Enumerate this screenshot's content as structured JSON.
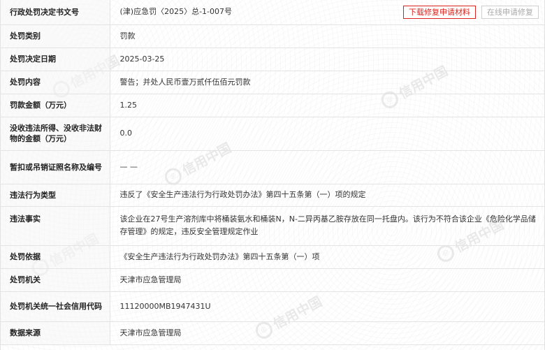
{
  "watermark": {
    "text": "信用中国",
    "logo_icon": "credit-china-logo-icon"
  },
  "actions": {
    "download_label": "下载修复申请材料",
    "online_label": "在线申请修复"
  },
  "rows": [
    {
      "key": "行政处罚决定书文号",
      "value": "(津)应急罚〈2025〉总-1-007号"
    },
    {
      "key": "处罚类别",
      "value": "罚款"
    },
    {
      "key": "处罚决定日期",
      "value": "2025-03-25"
    },
    {
      "key": "处罚内容",
      "value": "警告；并处人民币壹万贰仟伍佰元罚款"
    },
    {
      "key": "罚款金额（万元）",
      "value": "1.25"
    },
    {
      "key": "没收违法所得、没收非法财物的金额（万元）",
      "value": "0.0"
    },
    {
      "key": "暂扣或吊销证照名称及编号",
      "value": "— —"
    },
    {
      "key": "违法行为类型",
      "value": "违反了《安全生产违法行为行政处罚办法》第四十五条第（一）项的规定"
    },
    {
      "key": "违法事实",
      "value": "该企业在27号生产溶剂库中将桶装氨水和桶装N，N-二异丙基乙胺存放在同一托盘内。该行为不符合该企业《危险化学品储存管理》的规定，违反安全管理规定作业"
    },
    {
      "key": "处罚依据",
      "value": "《安全生产违法行为行政处罚办法》第四十五条第（一）项"
    },
    {
      "key": "处罚机关",
      "value": "天津市应急管理局"
    },
    {
      "key": "处罚机关统一社会信用代码",
      "value": "11120000MB1947431U"
    },
    {
      "key": "数据来源",
      "value": "天津市应急管理局"
    }
  ]
}
